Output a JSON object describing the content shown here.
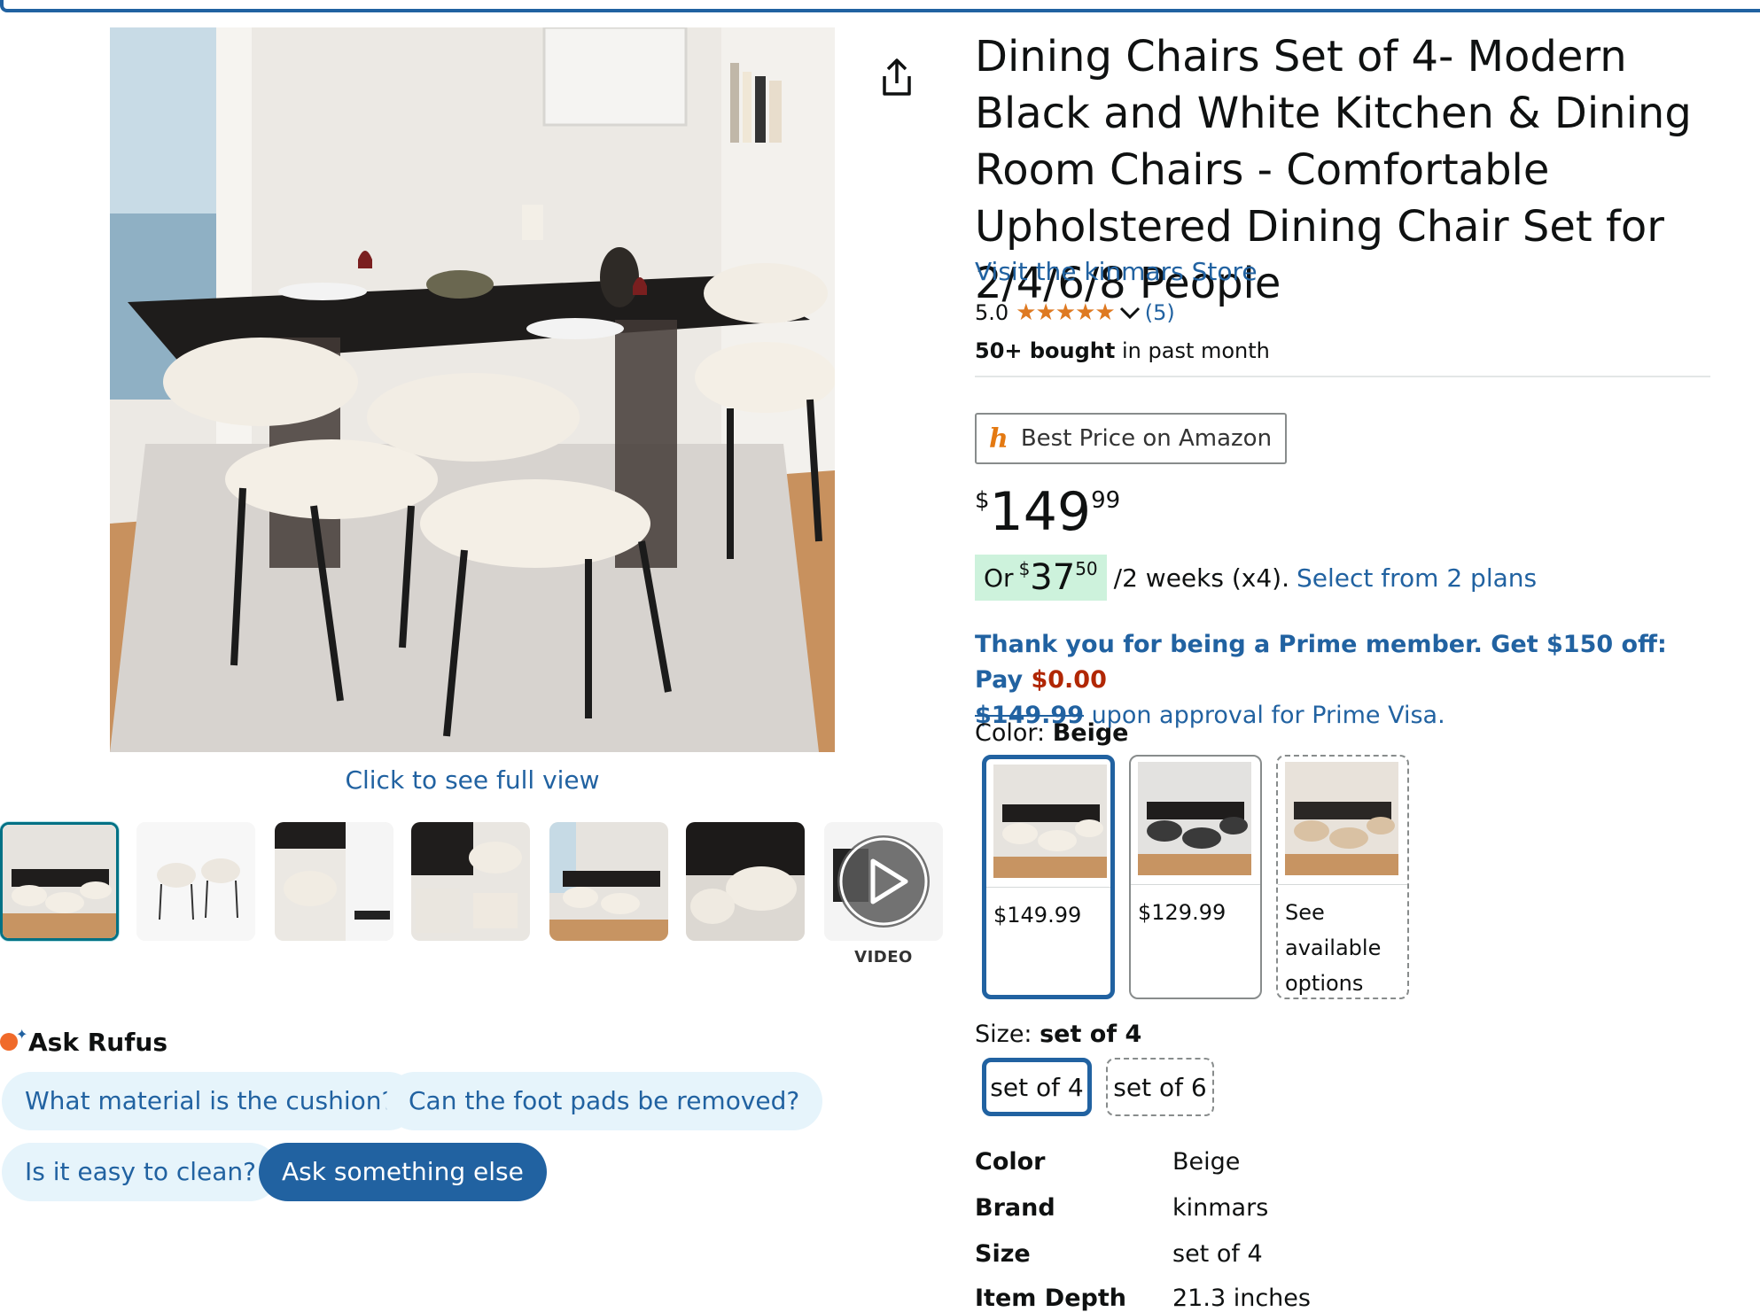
{
  "product": {
    "title": "Dining Chairs Set of 4- Modern Black and White Kitchen & Dining Room Chairs - Comfortable Upholstered Dining Chair Set for 2/4/6/8 People",
    "store_link": "Visit the kinmars Store",
    "rating": "5.0",
    "stars": "★★★★★",
    "rating_count": "(5)",
    "bought_bold": "50+ bought",
    "bought_rest": " in past month"
  },
  "gallery": {
    "click_full_view": "Click to see full view",
    "video_label": "VIDEO"
  },
  "best_price": {
    "label": "Best Price on Amazon",
    "icon": "h-logo-icon"
  },
  "price": {
    "symbol": "$",
    "whole": "149",
    "fraction": "99"
  },
  "installment": {
    "prefix": "Or ",
    "symbol": "$",
    "whole": "37",
    "fraction": "50",
    "suffix": "/2 weeks (x4).",
    "plans_link": "Select from 2 plans"
  },
  "prime": {
    "text1": "Thank you for being a Prime member. Get $150 off: Pay ",
    "red_price": "$0.00",
    "strike_price": "$149.99",
    "text2": " upon approval for Prime Visa."
  },
  "color": {
    "label": "Color: ",
    "selected": "Beige",
    "options": [
      {
        "price": "$149.99"
      },
      {
        "price": "$129.99"
      },
      {
        "price": "See available options"
      }
    ]
  },
  "size": {
    "label": "Size: ",
    "selected": "set of 4",
    "options": [
      "set of 4",
      "set of 6"
    ]
  },
  "specs": [
    {
      "key": "Color",
      "value": "Beige"
    },
    {
      "key": "Brand",
      "value": "kinmars"
    },
    {
      "key": "Size",
      "value": "set of 4"
    },
    {
      "key": "Item Depth",
      "value": "21.3 inches"
    }
  ],
  "rufus": {
    "title": "Ask Rufus",
    "chips": [
      "What material is the cushion?",
      "Can the foot pads be removed?",
      "Is it easy to clean?",
      "Ask something else"
    ]
  },
  "colors": {
    "link": "#2162a1",
    "star": "#de7921",
    "price_red": "#b12704",
    "installment_bg": "#cdf2dc"
  }
}
